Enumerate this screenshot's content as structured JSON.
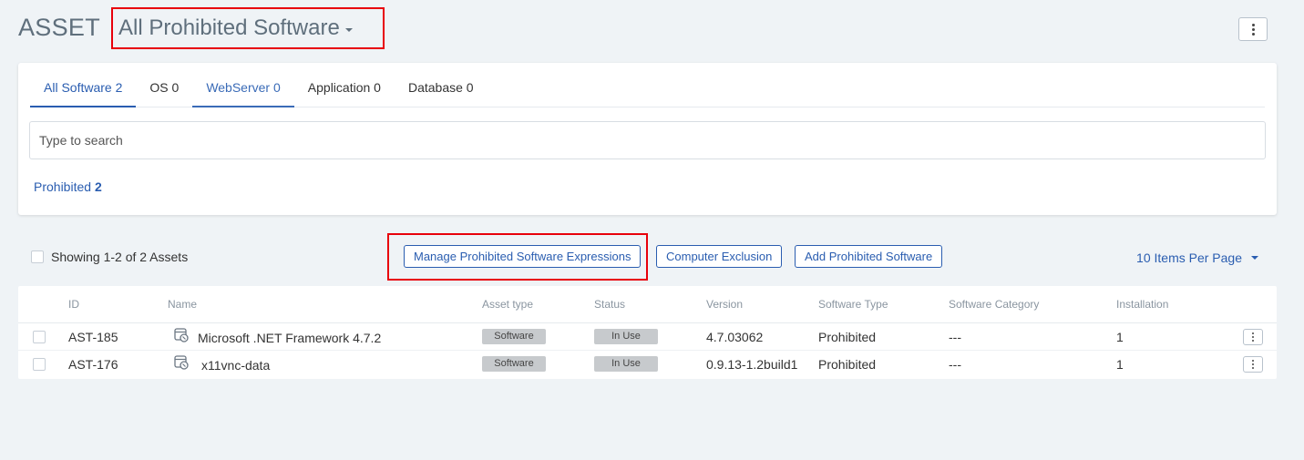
{
  "header": {
    "title": "ASSET",
    "view_label": "All Prohibited Software"
  },
  "tabs": [
    {
      "label": "All Software",
      "count": "2"
    },
    {
      "label": "OS",
      "count": "0"
    },
    {
      "label": "WebServer",
      "count": "0"
    },
    {
      "label": "Application",
      "count": "0"
    },
    {
      "label": "Database",
      "count": "0"
    }
  ],
  "search": {
    "placeholder": "Type to search"
  },
  "filter": {
    "label": "Prohibited",
    "count": "2"
  },
  "toolbar": {
    "showing": "Showing 1-2 of 2 Assets",
    "manage_button": "Manage Prohibited Software Expressions",
    "exclusion_button": "Computer Exclusion",
    "add_button": "Add Prohibited Software",
    "per_page": "10 Items Per Page"
  },
  "table": {
    "columns": [
      "ID",
      "Name",
      "Asset type",
      "Status",
      "Version",
      "Software Type",
      "Software Category",
      "Installation"
    ],
    "rows": [
      {
        "id": "AST-185",
        "name": "Microsoft .NET Framework 4.7.2",
        "asset_type": "Software",
        "status": "In Use",
        "version": "4.7.03062",
        "software_type": "Prohibited",
        "category": "---",
        "installation": "1"
      },
      {
        "id": "AST-176",
        "name": "x11vnc-data",
        "asset_type": "Software",
        "status": "In Use",
        "version": "0.9.13-1.2build1",
        "software_type": "Prohibited",
        "category": "---",
        "installation": "1"
      }
    ]
  },
  "colors": {
    "accent": "#2a5db0",
    "highlight": "#e8000b",
    "background": "#eff3f6"
  }
}
